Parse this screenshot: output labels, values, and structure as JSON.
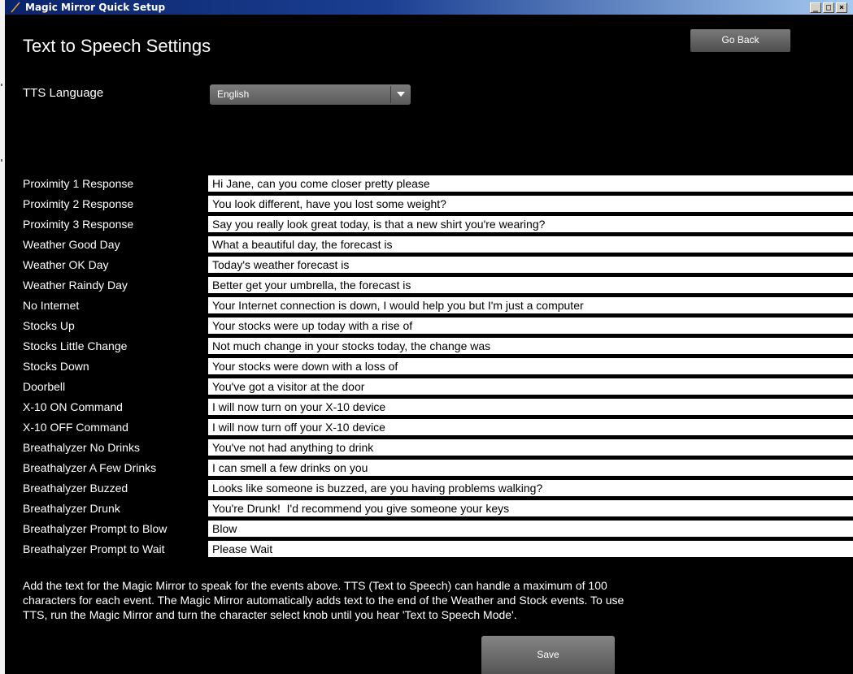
{
  "window": {
    "title": "Magic Mirror Quick Setup",
    "controls": {
      "minimize": "_",
      "maximize": "□",
      "close": "×"
    }
  },
  "header": {
    "title": "Text to Speech Settings",
    "go_back_label": "Go Back"
  },
  "language": {
    "label": "TTS Language",
    "selected": "English"
  },
  "responses": [
    {
      "label": "Proximity 1 Response",
      "value": "Hi Jane, can you come closer pretty please"
    },
    {
      "label": "Proximity 2 Response",
      "value": "You look different, have you lost some weight?"
    },
    {
      "label": "Proximity 3 Response",
      "value": "Say you really look great today, is that a new shirt you're wearing?"
    },
    {
      "label": "Weather Good Day",
      "value": "What a beautiful day, the forecast is"
    },
    {
      "label": "Weather OK Day",
      "value": "Today's weather forecast is"
    },
    {
      "label": "Weather Raindy Day",
      "value": "Better get your umbrella, the forecast is"
    },
    {
      "label": "No Internet",
      "value": "Your Internet connection is down, I would help you but I'm just a computer"
    },
    {
      "label": "Stocks Up",
      "value": "Your stocks were up today with a rise of"
    },
    {
      "label": "Stocks Little Change",
      "value": "Not much change in your stocks today, the change was"
    },
    {
      "label": "Stocks Down",
      "value": "Your stocks were down with a loss of"
    },
    {
      "label": "Doorbell",
      "value": "You've got a visitor at the door"
    },
    {
      "label": "X-10 ON Command",
      "value": "I will now turn on your X-10 device"
    },
    {
      "label": "X-10 OFF Command",
      "value": "I will now turn off your X-10 device"
    },
    {
      "label": "Breathalyzer No Drinks",
      "value": "You've not had anything to drink"
    },
    {
      "label": "Breathalyzer A Few Drinks",
      "value": "I can smell a few drinks on you"
    },
    {
      "label": "Breathalyzer Buzzed",
      "value": "Looks like someone is buzzed, are you having problems walking?"
    },
    {
      "label": "Breathalyzer Drunk",
      "value": "You're Drunk!  I'd recommend you give someone your keys"
    },
    {
      "label": "Breathalyzer Prompt to Blow",
      "value": "Blow"
    },
    {
      "label": "Breathalyzer Prompt to Wait",
      "value": "Please Wait"
    }
  ],
  "help": {
    "line1": "Add the text for the Magic Mirror to speak for the events above. TTS (Text to Speech) can handle a maximum of 100",
    "line2": "characters for each event. The Magic Mirror automatically adds text to the end of the Weather and Stock events. To use",
    "line3": "TTS, run the Magic Mirror and turn the character select knob until you hear 'Text to Speech Mode'."
  },
  "footer": {
    "save_label": "Save"
  },
  "colors": {
    "background": "#000000",
    "titlebar_start": "#0a246a",
    "titlebar_end": "#a6caf0",
    "button": "#6a6a6a",
    "field": "#ffffff"
  }
}
